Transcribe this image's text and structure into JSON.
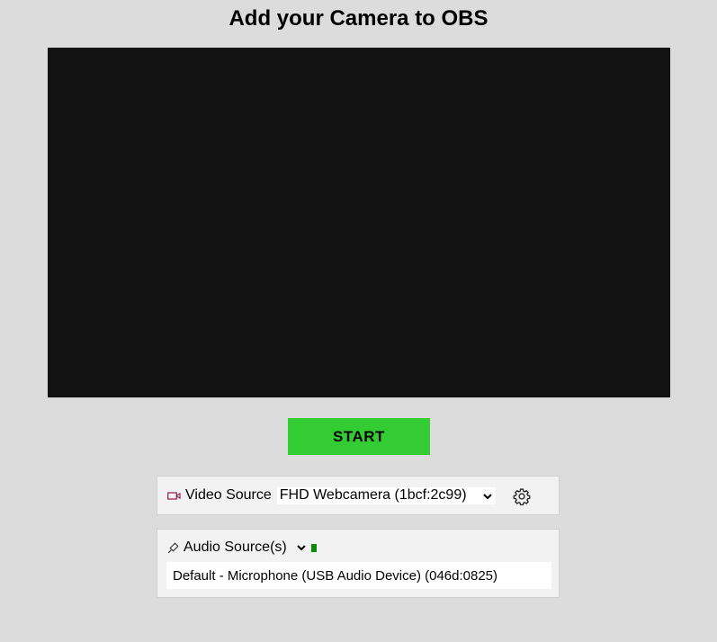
{
  "page": {
    "title": "Add your Camera to OBS"
  },
  "preview": {
    "background": "#121212"
  },
  "start_button": {
    "label": "START",
    "color": "#33cc33"
  },
  "video_source": {
    "icon": "video-camera-icon",
    "label": "Video Source",
    "selected": "FHD Webcamera (1bcf:2c99)",
    "settings_icon": "gear-icon"
  },
  "audio_source": {
    "icon": "microphone-icon",
    "label": "Audio Source(s)",
    "toggle_icon": "chevron-down-icon",
    "level_color": "#0b8a0b",
    "devices": [
      "Default - Microphone (USB Audio Device) (046d:0825)"
    ]
  }
}
